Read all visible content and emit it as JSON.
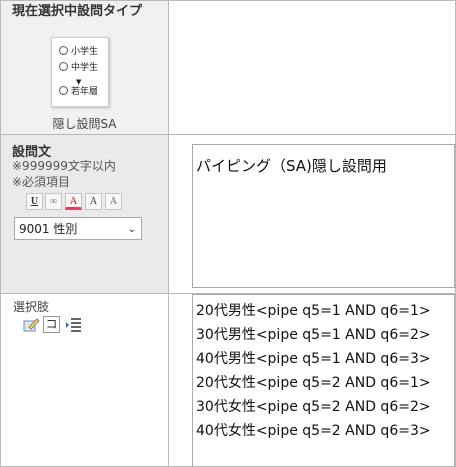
{
  "question_type": {
    "title": "現在選択中設問タイプ",
    "preview_options": [
      "小学生",
      "中学生",
      "若年層"
    ],
    "preview_arrow": "▼",
    "label": "隠し設問SA"
  },
  "question_text": {
    "title": "設問文",
    "char_limit_note": "※999999文字以内",
    "required_note": "※必須項目",
    "toolbar": {
      "underline": "U",
      "link": "∞",
      "color": "A",
      "size": "A",
      "clear": "A"
    },
    "select_value": "9001 性別",
    "select_chevron": "⌄",
    "value": "パイピング（SA)隠し設問用"
  },
  "choices": {
    "title": "選択肢",
    "icons": [
      "edit-icon",
      "katakana-ko-icon",
      "list-indent-icon"
    ],
    "ko_glyph": "コ",
    "items": [
      "20代男性<pipe q5=1 AND q6=1>",
      "30代男性<pipe q5=1 AND q6=2>",
      "40代男性<pipe q5=1 AND q6=3>",
      "20代女性<pipe q5=2 AND q6=1>",
      "30代女性<pipe q5=2 AND q6=2>",
      "40代女性<pipe q5=2 AND q6=3>"
    ]
  }
}
